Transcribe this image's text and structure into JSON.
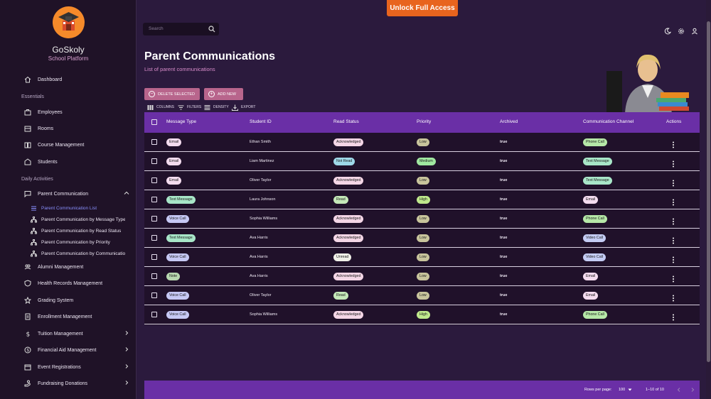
{
  "app": {
    "name": "GoSkoly",
    "subtitle": "School Platform"
  },
  "unlock_label": "Unlock Full Access",
  "search": {
    "placeholder": "Search"
  },
  "sidebar": {
    "dashboard": "Dashboard",
    "section_essentials": "Essentials",
    "essentials": [
      "Employees",
      "Rooms",
      "Course Management",
      "Students"
    ],
    "section_daily": "Daily Activities",
    "parent_communication": "Parent Communication",
    "sub_items": [
      "Parent Communication List",
      "Parent Communication by Message Type",
      "Parent Communication by Read Status",
      "Parent Communication by Priority",
      "Parent Communication by Communication Channel"
    ],
    "daily": [
      "Alumni Management",
      "Health Records Management",
      "Grading System",
      "Enrollment Management",
      "Tuition Management",
      "Financial Aid Management",
      "Event Registrations",
      "Fundraising Donations"
    ]
  },
  "page": {
    "title": "Parent Communications",
    "subtitle": "List of parent communications"
  },
  "actions": {
    "delete": "DELETE SELECTED",
    "add": "ADD NEW"
  },
  "toolbar": {
    "columns": "COLUMNS",
    "filters": "FILTERS",
    "density": "DENSITY",
    "export": "EXPORT"
  },
  "table": {
    "headers": [
      "Message Type",
      "Student ID",
      "Read Status",
      "Priority",
      "Archived",
      "Communication Channel",
      "Actions"
    ],
    "rows": [
      {
        "type": "Email",
        "student": "Ethan Smith",
        "status": "Acknowledged",
        "priority": "Low",
        "archived": "true",
        "channel": "Phone Call"
      },
      {
        "type": "Email",
        "student": "Liam Martinez",
        "status": "Not Read",
        "priority": "Medium",
        "archived": "true",
        "channel": "Text Message"
      },
      {
        "type": "Email",
        "student": "Oliver Taylor",
        "status": "Acknowledged",
        "priority": "Low",
        "archived": "true",
        "channel": "Text Message"
      },
      {
        "type": "Text Message",
        "student": "Laura Johnson",
        "status": "Read",
        "priority": "High",
        "archived": "true",
        "channel": "Email"
      },
      {
        "type": "Voice Call",
        "student": "Sophia Williams",
        "status": "Acknowledged",
        "priority": "Low",
        "archived": "true",
        "channel": "Phone Call"
      },
      {
        "type": "Text Message",
        "student": "Ava Harris",
        "status": "Acknowledged",
        "priority": "Low",
        "archived": "true",
        "channel": "Video Call"
      },
      {
        "type": "Voice Call",
        "student": "Ava Harris",
        "status": "Unread",
        "priority": "Low",
        "archived": "true",
        "channel": "Video Call"
      },
      {
        "type": "Note",
        "student": "Ava Harris",
        "status": "Acknowledged",
        "priority": "Low",
        "archived": "true",
        "channel": "Email"
      },
      {
        "type": "Voice Call",
        "student": "Oliver Taylor",
        "status": "Read",
        "priority": "Low",
        "archived": "true",
        "channel": "Email"
      },
      {
        "type": "Voice Call",
        "student": "Sophia Williams",
        "status": "Acknowledged",
        "priority": "High",
        "archived": "true",
        "channel": "Phone Call"
      }
    ]
  },
  "chip_colors": {
    "Email": "#f4dcef",
    "Text Message": "#a8e6c8",
    "Voice Call": "#c6c8f4",
    "Note": "#b8d8b0",
    "Acknowledged": "#f4d6e6",
    "Not Read": "#9ed8e8",
    "Read": "#c4e8b8",
    "Unread": "#f0f0e8",
    "Low": "#c8c49c",
    "Medium": "#a0e8a0",
    "High": "#bfe88c",
    "Phone Call": "#b6e8a8",
    "Video Call": "#c4ccf4"
  },
  "footer": {
    "rows_per_page": "Rows per page:",
    "rows_value": "100",
    "range": "1–10 of 10"
  }
}
